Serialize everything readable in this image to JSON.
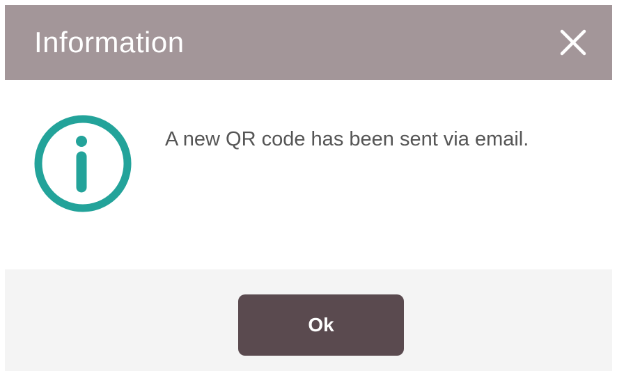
{
  "dialog": {
    "title": "Information",
    "close_icon": "close-icon",
    "info_icon": "info-circle-icon",
    "message": "A new QR code has been sent via email.",
    "ok_label": "Ok"
  },
  "colors": {
    "header_bg": "#a39699",
    "accent": "#23a39a",
    "button_bg": "#5a4a4f",
    "footer_bg": "#f4f4f4"
  }
}
